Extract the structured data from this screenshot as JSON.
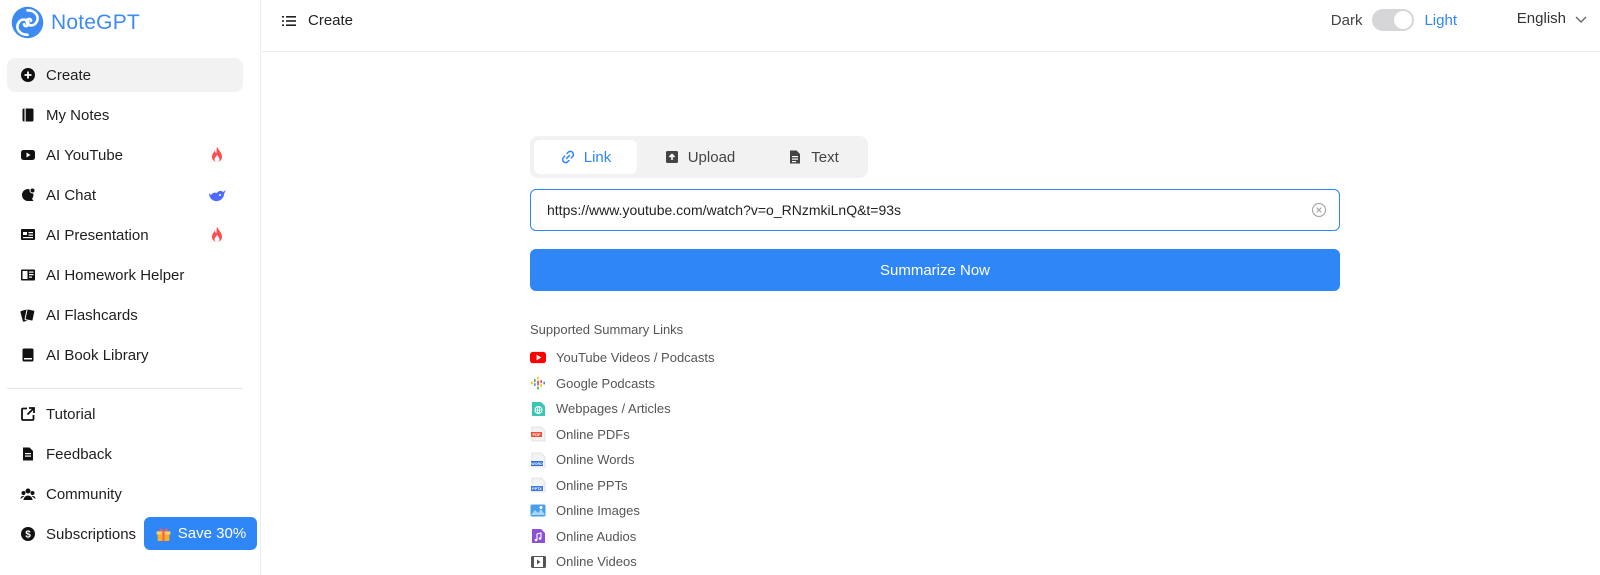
{
  "app": {
    "name": "NoteGPT",
    "accent": "#2f86f6"
  },
  "sidebar": {
    "items": [
      {
        "label": "Create",
        "icon": "plus-circle-icon",
        "active": true
      },
      {
        "label": "My Notes",
        "icon": "notebook-icon"
      },
      {
        "label": "AI YouTube",
        "icon": "youtube-icon",
        "badge": "fire-icon"
      },
      {
        "label": "AI Chat",
        "icon": "chat-icon",
        "badge": "whale-icon"
      },
      {
        "label": "AI Presentation",
        "icon": "presentation-icon",
        "badge": "fire-icon"
      },
      {
        "label": "AI Homework Helper",
        "icon": "homework-icon"
      },
      {
        "label": "AI Flashcards",
        "icon": "flashcards-icon"
      },
      {
        "label": "AI Book Library",
        "icon": "book-icon"
      }
    ],
    "secondary": [
      {
        "label": "Tutorial",
        "icon": "external-link-icon"
      },
      {
        "label": "Feedback",
        "icon": "document-icon"
      },
      {
        "label": "Community",
        "icon": "community-icon"
      },
      {
        "label": "Subscriptions",
        "icon": "dollar-icon"
      }
    ],
    "save_label": "Save 30%"
  },
  "header": {
    "title": "Create",
    "theme_dark": "Dark",
    "theme_light": "Light",
    "language": "English"
  },
  "main": {
    "tabs": [
      {
        "label": "Link",
        "icon": "link-icon",
        "active": true
      },
      {
        "label": "Upload",
        "icon": "upload-icon"
      },
      {
        "label": "Text",
        "icon": "text-doc-icon"
      }
    ],
    "url_value": "https://www.youtube.com/watch?v=o_RNzmkiLnQ&t=93s",
    "summarize_label": "Summarize Now",
    "supported_title": "Supported Summary Links",
    "supported": [
      {
        "label": "YouTube Videos / Podcasts",
        "icon": "youtube-icon"
      },
      {
        "label": "Google Podcasts",
        "icon": "google-podcasts-icon"
      },
      {
        "label": "Webpages / Articles",
        "icon": "globe-icon"
      },
      {
        "label": "Online PDFs",
        "icon": "pdf-icon"
      },
      {
        "label": "Online Words",
        "icon": "word-icon"
      },
      {
        "label": "Online PPTs",
        "icon": "ppt-icon"
      },
      {
        "label": "Online Images",
        "icon": "image-icon"
      },
      {
        "label": "Online Audios",
        "icon": "audio-icon"
      },
      {
        "label": "Online Videos",
        "icon": "video-icon"
      }
    ]
  }
}
